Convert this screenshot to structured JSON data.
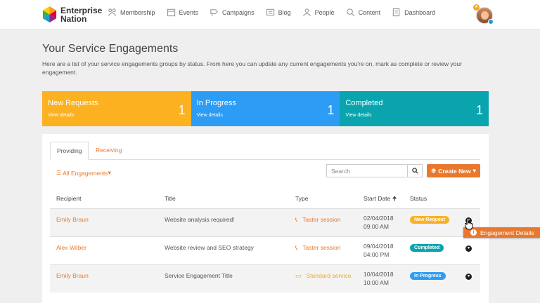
{
  "brand": {
    "line1": "Enterprise",
    "line2": "Nation"
  },
  "nav": [
    {
      "label": "Membership",
      "icon": "membership-icon"
    },
    {
      "label": "Events",
      "icon": "events-icon"
    },
    {
      "label": "Campaigns",
      "icon": "campaigns-icon"
    },
    {
      "label": "Blog",
      "icon": "blog-icon"
    },
    {
      "label": "People",
      "icon": "people-icon"
    },
    {
      "label": "Content",
      "icon": "content-icon"
    },
    {
      "label": "Dashboard",
      "icon": "dashboard-icon"
    }
  ],
  "page": {
    "title": "Your Service Engagements",
    "intro": "Here are a list of your service engagements groups by status. From here you can update any current engagements you're on, mark as complete or review your engagement."
  },
  "cards": [
    {
      "title": "New Requests",
      "link": "View details",
      "count": "1",
      "color": "#fbb120"
    },
    {
      "title": "In Progress",
      "link": "View details",
      "count": "1",
      "color": "#2d9cf4"
    },
    {
      "title": "Completed",
      "link": "View details",
      "count": "1",
      "color": "#0aa4ae"
    }
  ],
  "tabs": {
    "providing": "Providing",
    "receiving": "Receiving"
  },
  "filter": {
    "label": "All Engagements"
  },
  "search": {
    "placeholder": "Search"
  },
  "create": {
    "label": "Create New"
  },
  "table": {
    "headers": {
      "recipient": "Recipient",
      "title": "Title",
      "type": "Type",
      "start": "Start Date",
      "status": "Status"
    },
    "rows": [
      {
        "recipient": "Emily Braun",
        "title": "Website analysis required!",
        "type": "Taster session",
        "date": "02/04/2018",
        "time": "09:00 AM",
        "status": "New Request",
        "status_color": "#fbb120"
      },
      {
        "recipient": "Alex Wilber",
        "title": "Website review and SEO strategy",
        "type": "Taster session",
        "date": "09/04/2018",
        "time": "04:00 PM",
        "status": "Completed",
        "status_color": "#0aa4ae"
      },
      {
        "recipient": "Emily Braun",
        "title": "Service Engagement Title",
        "type": "Standard service",
        "date": "10/04/2018",
        "time": "10:00 AM",
        "status": "In Progress",
        "status_color": "#2d9cf4"
      }
    ]
  },
  "tooltip": {
    "label": "Engagement Details"
  },
  "accent": "#e8782d"
}
